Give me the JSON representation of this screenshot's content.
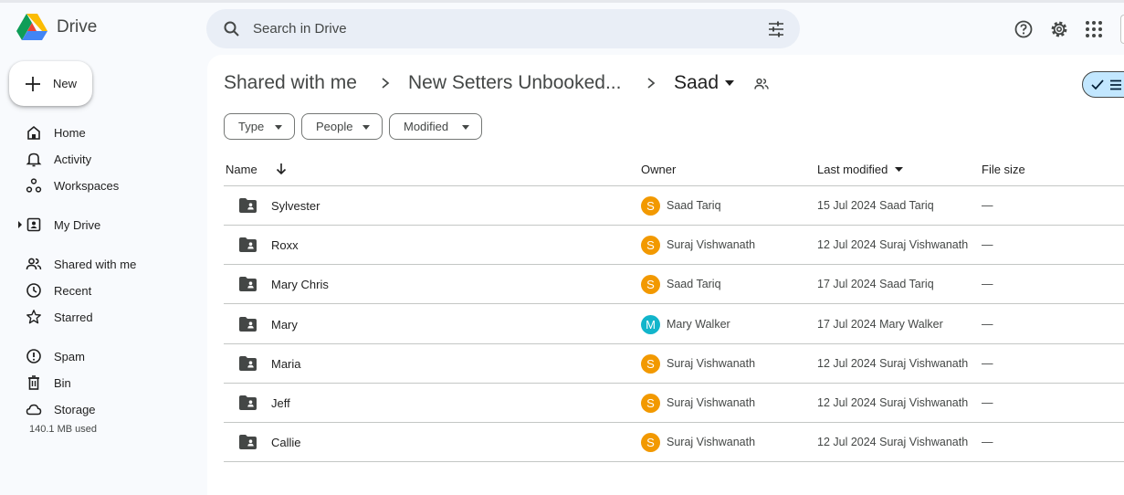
{
  "app": {
    "name": "Drive"
  },
  "search": {
    "placeholder": "Search in Drive"
  },
  "nav": {
    "new_label": "New",
    "items": [
      {
        "label": "Home",
        "icon": "home-icon"
      },
      {
        "label": "Activity",
        "icon": "bell-icon"
      },
      {
        "label": "Workspaces",
        "icon": "workspaces-icon"
      },
      {
        "label": "My Drive",
        "icon": "my-drive-icon"
      },
      {
        "label": "Shared with me",
        "icon": "shared-people-icon"
      },
      {
        "label": "Recent",
        "icon": "clock-icon"
      },
      {
        "label": "Starred",
        "icon": "star-icon"
      },
      {
        "label": "Spam",
        "icon": "spam-icon"
      },
      {
        "label": "Bin",
        "icon": "bin-icon"
      },
      {
        "label": "Storage",
        "icon": "cloud-icon"
      }
    ],
    "storage_used": "140.1 MB used"
  },
  "breadcrumb": {
    "items": [
      "Shared with me",
      "New Setters Unbooked...",
      "Saad"
    ]
  },
  "filters": {
    "type": "Type",
    "people": "People",
    "modified": "Modified"
  },
  "table": {
    "headers": {
      "name": "Name",
      "owner": "Owner",
      "last_modified": "Last modified",
      "file_size": "File size"
    },
    "rows": [
      {
        "name": "Sylvester",
        "owner_initial": "S",
        "owner": "Saad Tariq",
        "modified": "15 Jul 2024 Saad Tariq",
        "size": "—",
        "avatar_color": "#f29900"
      },
      {
        "name": "Roxx",
        "owner_initial": "S",
        "owner": "Suraj Vishwanath",
        "modified": "12 Jul 2024 Suraj Vishwanath",
        "size": "—",
        "avatar_color": "#f29900"
      },
      {
        "name": "Mary Chris",
        "owner_initial": "S",
        "owner": "Saad Tariq",
        "modified": "17 Jul 2024 Saad Tariq",
        "size": "—",
        "avatar_color": "#f29900"
      },
      {
        "name": "Mary",
        "owner_initial": "M",
        "owner": "Mary Walker",
        "modified": "17 Jul 2024 Mary Walker",
        "size": "—",
        "avatar_color": "#12b5cb"
      },
      {
        "name": "Maria",
        "owner_initial": "S",
        "owner": "Suraj Vishwanath",
        "modified": "12 Jul 2024 Suraj Vishwanath",
        "size": "—",
        "avatar_color": "#f29900"
      },
      {
        "name": "Jeff",
        "owner_initial": "S",
        "owner": "Suraj Vishwanath",
        "modified": "12 Jul 2024 Suraj Vishwanath",
        "size": "—",
        "avatar_color": "#f29900"
      },
      {
        "name": "Callie",
        "owner_initial": "S",
        "owner": "Suraj Vishwanath",
        "modified": "12 Jul 2024 Suraj Vishwanath",
        "size": "—",
        "avatar_color": "#f29900"
      }
    ]
  },
  "colors": {
    "accent": "#0b57d0",
    "search_bg": "#e9eef6",
    "selected_view_bg": "#c2e7ff"
  }
}
